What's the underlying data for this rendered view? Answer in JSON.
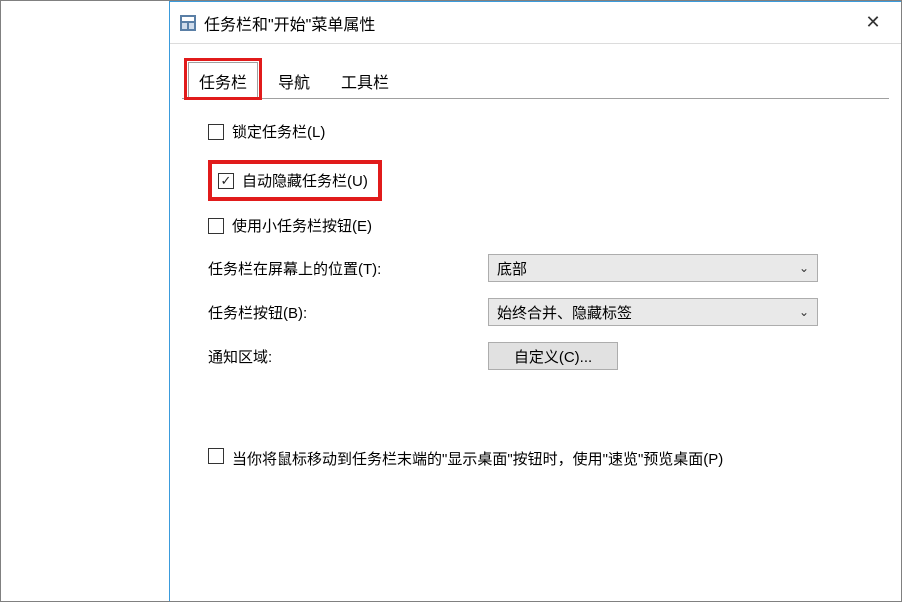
{
  "window": {
    "title": "任务栏和\"开始\"菜单属性",
    "close_label": "✕"
  },
  "tabs": {
    "taskbar": "任务栏",
    "navigation": "导航",
    "toolbars": "工具栏"
  },
  "checkboxes": {
    "lock": {
      "label": "锁定任务栏(L)",
      "checked": false
    },
    "autohide": {
      "label": "自动隐藏任务栏(U)",
      "checked": true
    },
    "small": {
      "label": "使用小任务栏按钮(E)",
      "checked": false
    },
    "preview": {
      "label": "当你将鼠标移动到任务栏末端的\"显示桌面\"按钮时，使用\"速览\"预览桌面(P)",
      "checked": false
    }
  },
  "form": {
    "position": {
      "label": "任务栏在屏幕上的位置(T):",
      "value": "底部"
    },
    "buttons": {
      "label": "任务栏按钮(B):",
      "value": "始终合并、隐藏标签"
    },
    "notify": {
      "label": "通知区域:",
      "button": "自定义(C)..."
    }
  },
  "icons": {
    "chevron_down": "⌄",
    "checkmark": "✓"
  }
}
